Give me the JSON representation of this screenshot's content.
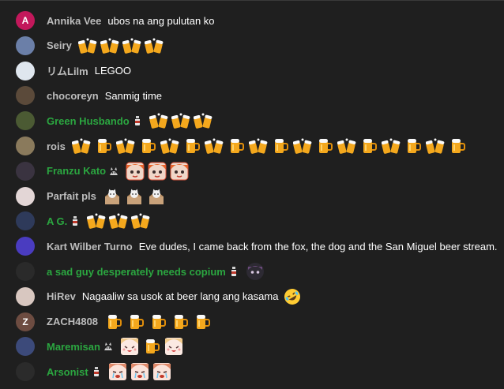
{
  "messages": [
    {
      "author": "Annika Vee",
      "member": false,
      "badge": null,
      "avatar": {
        "letter": "A",
        "color": "#c2185b"
      },
      "text": "ubos na ang pulutan ko",
      "emotes": []
    },
    {
      "author": "Seiry",
      "member": false,
      "badge": null,
      "avatar": {
        "letter": "",
        "color": "#6b7fa8"
      },
      "text": "",
      "emotes": [
        "beers-cheers",
        "beers-cheers",
        "beers-cheers",
        "beers-cheers"
      ]
    },
    {
      "author": "リムLilm",
      "member": false,
      "badge": null,
      "avatar": {
        "letter": "",
        "color": "#dfe6ee"
      },
      "text": "LEGOO",
      "emotes": []
    },
    {
      "author": "chocoreyn",
      "member": false,
      "badge": null,
      "avatar": {
        "letter": "",
        "color": "#5b4a3a"
      },
      "text": "Sanmig time",
      "emotes": []
    },
    {
      "author": "Green Husbando",
      "member": true,
      "badge": "bottle-badge",
      "avatar": {
        "letter": "",
        "color": "#4b5a33"
      },
      "text": "",
      "emotes": [
        "beers-cheers",
        "beers-cheers",
        "beers-cheers"
      ]
    },
    {
      "author": "rois",
      "member": false,
      "badge": null,
      "avatar": {
        "letter": "",
        "color": "#8a7a5c"
      },
      "text": "",
      "emotes": [
        "beers-cheers",
        "beer-mug",
        "beers-cheers",
        "beer-mug",
        "beers-cheers",
        "beer-mug",
        "beers-cheers",
        "beer-mug",
        "beers-cheers",
        "beer-mug",
        "beers-cheers",
        "beer-mug",
        "beers-cheers",
        "beer-mug",
        "beers-cheers",
        "beer-mug",
        "beers-cheers",
        "beer-mug"
      ]
    },
    {
      "author": "Franzu Kato",
      "member": true,
      "badge": "cat-badge",
      "avatar": {
        "letter": "",
        "color": "#3a3340"
      },
      "text": "",
      "emotes": [
        "anime-face",
        "anime-face",
        "anime-face"
      ]
    },
    {
      "author": "Parfait pls",
      "member": false,
      "badge": null,
      "avatar": {
        "letter": "",
        "color": "#e3d6d6"
      },
      "text": "",
      "emotes": [
        "box-cat",
        "box-cat",
        "box-cat"
      ]
    },
    {
      "author": "A G.",
      "member": true,
      "badge": "bottle-badge",
      "avatar": {
        "letter": "",
        "color": "#2e3a5a"
      },
      "text": "",
      "emotes": [
        "beers-cheers",
        "beers-cheers",
        "beers-cheers"
      ]
    },
    {
      "author": "Kart Wilber Turno",
      "member": false,
      "badge": null,
      "avatar": {
        "letter": "",
        "color": "#4a3cc0"
      },
      "text": "Eve dudes, I came back from the fox, the dog and the San Miguel beer stream.",
      "emotes": []
    },
    {
      "author": "a sad guy desperately needs copium",
      "member": true,
      "badge": "bottle-badge",
      "avatar": {
        "letter": "",
        "color": "#2a2a2a"
      },
      "text": "",
      "emotes": [
        "dark-face"
      ]
    },
    {
      "author": "HiRev",
      "member": false,
      "badge": null,
      "avatar": {
        "letter": "",
        "color": "#d8c7c0"
      },
      "text": "Nagaaliw sa usok at beer lang ang kasama",
      "emotes": [
        "rofl-emoji"
      ]
    },
    {
      "author": "ZACH4808",
      "member": false,
      "badge": null,
      "avatar": {
        "letter": "Z",
        "color": "#6d4c41"
      },
      "text": "",
      "emotes": [
        "beer-mug",
        "beer-mug",
        "beer-mug",
        "beer-mug",
        "beer-mug"
      ]
    },
    {
      "author": "Maremisan",
      "member": true,
      "badge": "cat-badge",
      "avatar": {
        "letter": "",
        "color": "#3c4a7a"
      },
      "text": "",
      "emotes": [
        "anime-cheer",
        "beer-mug",
        "anime-cheer"
      ]
    },
    {
      "author": "Arsonist",
      "member": true,
      "badge": "bottle-badge",
      "avatar": {
        "letter": "",
        "color": "#2b2b2b"
      },
      "text": "",
      "emotes": [
        "anime-cry",
        "anime-cry",
        "anime-cry"
      ]
    }
  ],
  "colors": {
    "background": "#1f1f1f",
    "author_default": "#bdbdbd",
    "author_member": "#2ba640",
    "text": "#ffffff"
  }
}
